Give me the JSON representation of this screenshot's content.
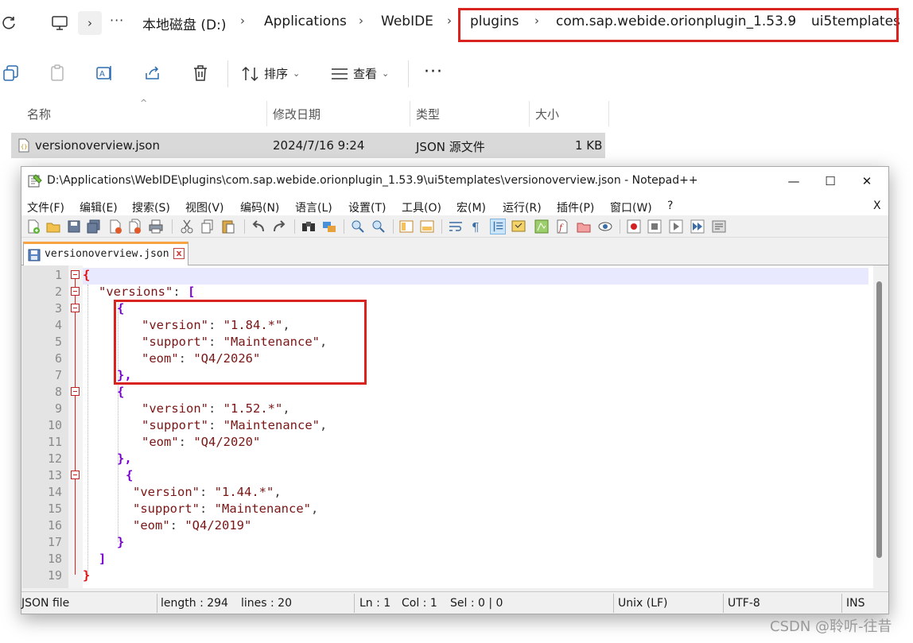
{
  "explorer": {
    "breadcrumbs": [
      "本地磁盘 (D:)",
      "Applications",
      "WebIDE",
      "plugins",
      "com.sap.webide.orionplugin_1.53.9",
      "ui5templates"
    ],
    "more_crumbs": "···",
    "toolbar": {
      "sort_label": "排序",
      "view_label": "查看",
      "more_label": "···"
    },
    "columns": {
      "name": "名称",
      "date": "修改日期",
      "type": "类型",
      "size": "大小"
    },
    "files": [
      {
        "name": "versionoverview.json",
        "date": "2024/7/16 9:24",
        "type": "JSON 源文件",
        "size": "1 KB"
      }
    ]
  },
  "notepad": {
    "title": "D:\\Applications\\WebIDE\\plugins\\com.sap.webide.orionplugin_1.53.9\\ui5templates\\versionoverview.json - Notepad++",
    "window_buttons": {
      "minimize": "—",
      "maximize": "☐",
      "close": "✕"
    },
    "menu": [
      "文件(F)",
      "编辑(E)",
      "搜索(S)",
      "视图(V)",
      "编码(N)",
      "语言(L)",
      "设置(T)",
      "工具(O)",
      "宏(M)",
      "运行(R)",
      "插件(P)",
      "窗口(W)",
      "?"
    ],
    "menu_close": "X",
    "tab": {
      "label": "versionoverview.json",
      "close": "x"
    },
    "line_numbers": [
      "1",
      "2",
      "3",
      "4",
      "5",
      "6",
      "7",
      "8",
      "9",
      "10",
      "11",
      "12",
      "13",
      "14",
      "15",
      "16",
      "17",
      "18",
      "19"
    ],
    "code": {
      "open": "{",
      "versions_key": "\"versions\"",
      "colon": ": ",
      "bracket_open": "[",
      "entries": [
        {
          "open": "{",
          "version_key": "\"version\"",
          "version": "\"1.84.*\"",
          "support_key": "\"support\"",
          "support": "\"Maintenance\"",
          "eom_key": "\"eom\"",
          "eom": "\"Q4/2026\"",
          "close": "},"
        },
        {
          "open": "{",
          "version_key": "\"version\"",
          "version": "\"1.52.*\"",
          "support_key": "\"support\"",
          "support": "\"Maintenance\"",
          "eom_key": "\"eom\"",
          "eom": "\"Q4/2020\"",
          "close": "},"
        },
        {
          "open": "{",
          "version_key": "\"version\"",
          "version": "\"1.44.*\"",
          "support_key": "\"support\"",
          "support": "\"Maintenance\"",
          "eom_key": "\"eom\"",
          "eom": "\"Q4/2019\"",
          "close": "}"
        }
      ],
      "bracket_close": "]",
      "close": "}"
    },
    "status": {
      "file_type": "JSON file",
      "length": "length : 294",
      "lines": "lines : 20",
      "ln": "Ln : 1",
      "col": "Col : 1",
      "sel": "Sel : 0 | 0",
      "eol": "Unix (LF)",
      "encoding": "UTF-8",
      "mode": "INS"
    }
  },
  "watermark": "CSDN @聆听-往昔"
}
